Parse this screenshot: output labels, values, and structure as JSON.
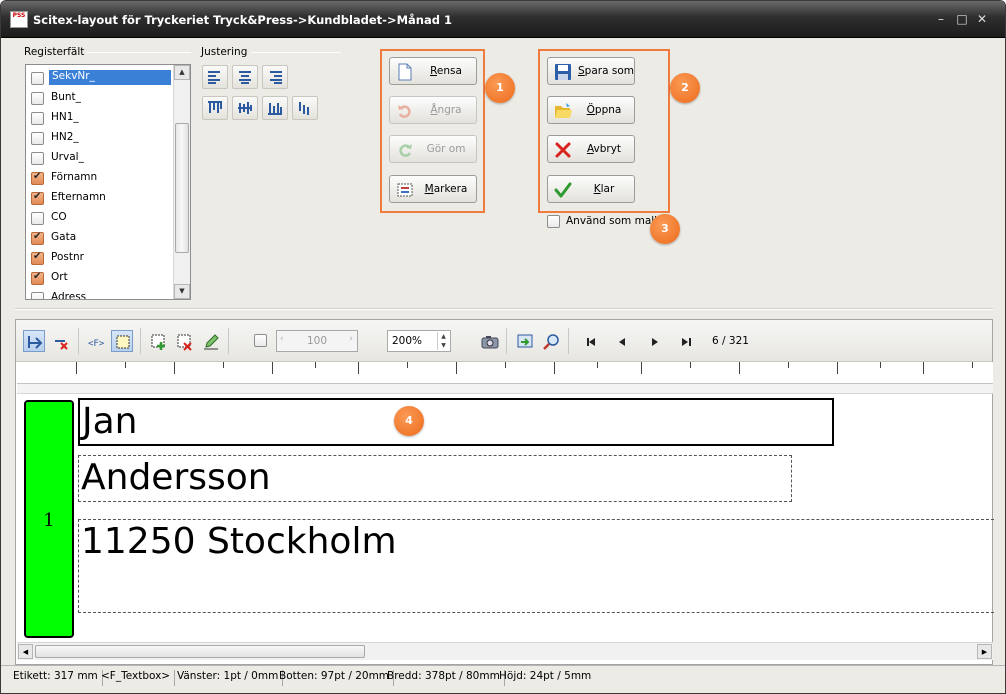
{
  "window": {
    "title": "Scitex-layout för Tryckeriet Tryck&Press->Kundbladet->Månad 1",
    "app_icon_text": "PSS",
    "controls": [
      "minimize",
      "maximize",
      "close"
    ]
  },
  "register_fields": {
    "group_label": "Registerfält",
    "items": [
      {
        "label": "SekvNr_",
        "checked": false,
        "selected": true
      },
      {
        "label": "Bunt_",
        "checked": false
      },
      {
        "label": "HN1_",
        "checked": false
      },
      {
        "label": "HN2_",
        "checked": false
      },
      {
        "label": "Urval_",
        "checked": false
      },
      {
        "label": "Förnamn",
        "checked": true
      },
      {
        "label": "Efternamn",
        "checked": true
      },
      {
        "label": "CO",
        "checked": false
      },
      {
        "label": "Gata",
        "checked": true
      },
      {
        "label": "Postnr",
        "checked": true
      },
      {
        "label": "Ort",
        "checked": true
      },
      {
        "label": "Adress",
        "checked": false
      }
    ]
  },
  "alignment": {
    "group_label": "Justering",
    "buttons": [
      "align-left-icon",
      "align-center-icon",
      "align-right-icon",
      "align-top-icon",
      "align-middle-icon",
      "align-bottom-icon",
      "align-baseline-icon"
    ]
  },
  "edit_buttons": {
    "rensa": "Rensa",
    "angra": "Ångra",
    "gor_om": "Gör om",
    "markera": "Markera"
  },
  "file_buttons": {
    "spara_som": "Spara som",
    "oppna": "Öppna",
    "avbryt": "Avbryt",
    "klar": "Klar"
  },
  "use_as_template": {
    "label": "Använd som mall",
    "checked": false
  },
  "badges": [
    "1",
    "2",
    "3",
    "4"
  ],
  "toolbar": {
    "opacity_value": "100",
    "zoom_value": "200%",
    "page_counter": "6 / 321"
  },
  "canvas": {
    "label_number": "1",
    "fields": [
      "Jan",
      "Andersson",
      "11250 Stockholm"
    ]
  },
  "statusbar": {
    "etikett": "Etikett: 317 mm",
    "type": "<F_Textbox>",
    "vanster": "Vänster: 1pt / 0mm",
    "botten": "Botten: 97pt / 20mm",
    "bredd": "Bredd: 378pt / 80mm",
    "hojd": "Höjd: 24pt / 5mm"
  },
  "colors": {
    "accent_orange": "#f07b3f",
    "badge_orange": "#ec6b1c",
    "label_green": "#00ff00",
    "selection_blue": "#3a80d6"
  }
}
